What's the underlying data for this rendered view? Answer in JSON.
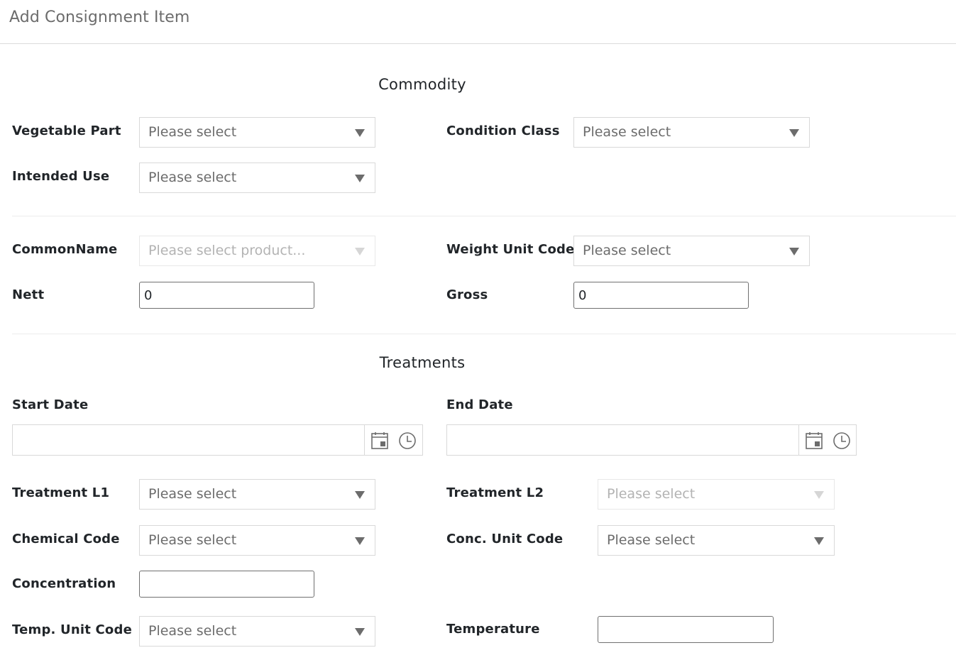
{
  "header": {
    "title": "Add Consignment Item"
  },
  "commodity": {
    "title": "Commodity",
    "vegetable_part": {
      "label": "Vegetable Part",
      "value": "Please select"
    },
    "condition_class": {
      "label": "Condition Class",
      "value": "Please select"
    },
    "intended_use": {
      "label": "Intended Use",
      "value": "Please select"
    },
    "common_name": {
      "label": "CommonName",
      "value": "Please select product...",
      "disabled": true
    },
    "weight_unit_code": {
      "label": "Weight Unit Code",
      "value": "Please select"
    },
    "nett": {
      "label": "Nett",
      "value": "0"
    },
    "gross": {
      "label": "Gross",
      "value": "0"
    }
  },
  "treatments": {
    "title": "Treatments",
    "start_date": {
      "label": "Start Date",
      "value": ""
    },
    "end_date": {
      "label": "End Date",
      "value": ""
    },
    "treatment_l1": {
      "label": "Treatment L1",
      "value": "Please select"
    },
    "treatment_l2": {
      "label": "Treatment L2",
      "value": "Please select",
      "disabled": true
    },
    "chemical_code": {
      "label": "Chemical Code",
      "value": "Please select"
    },
    "conc_unit_code": {
      "label": "Conc. Unit Code",
      "value": "Please select"
    },
    "concentration": {
      "label": "Concentration",
      "value": ""
    },
    "temp_unit_code": {
      "label": "Temp. Unit Code",
      "value": "Please select"
    },
    "temperature": {
      "label": "Temperature",
      "value": ""
    }
  },
  "icons": {
    "calendar": "calendar-icon",
    "clock": "clock-icon",
    "dropdown": "chevron-down-icon"
  },
  "colors": {
    "label": "#212529",
    "placeholder": "#6c6c6c",
    "disabled": "#b3b3b3",
    "border": "#d9d9d9"
  }
}
